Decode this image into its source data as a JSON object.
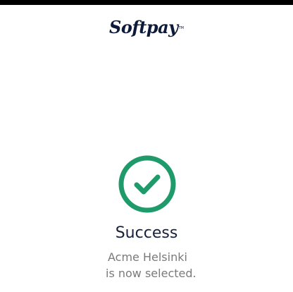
{
  "brand": {
    "logo_text": "Softpay",
    "logo_tm": "TM",
    "logo_color": "#0e1a3a"
  },
  "status": {
    "icon": "check-circle-icon",
    "icon_color": "#1f9a6a",
    "title": "Success",
    "merchant_name": "Acme Helsinki",
    "message": "is now selected."
  },
  "colors": {
    "background": "#ffffff",
    "top_bar": "#000000",
    "title_text": "#17213a",
    "body_text": "#7a7a7a"
  }
}
